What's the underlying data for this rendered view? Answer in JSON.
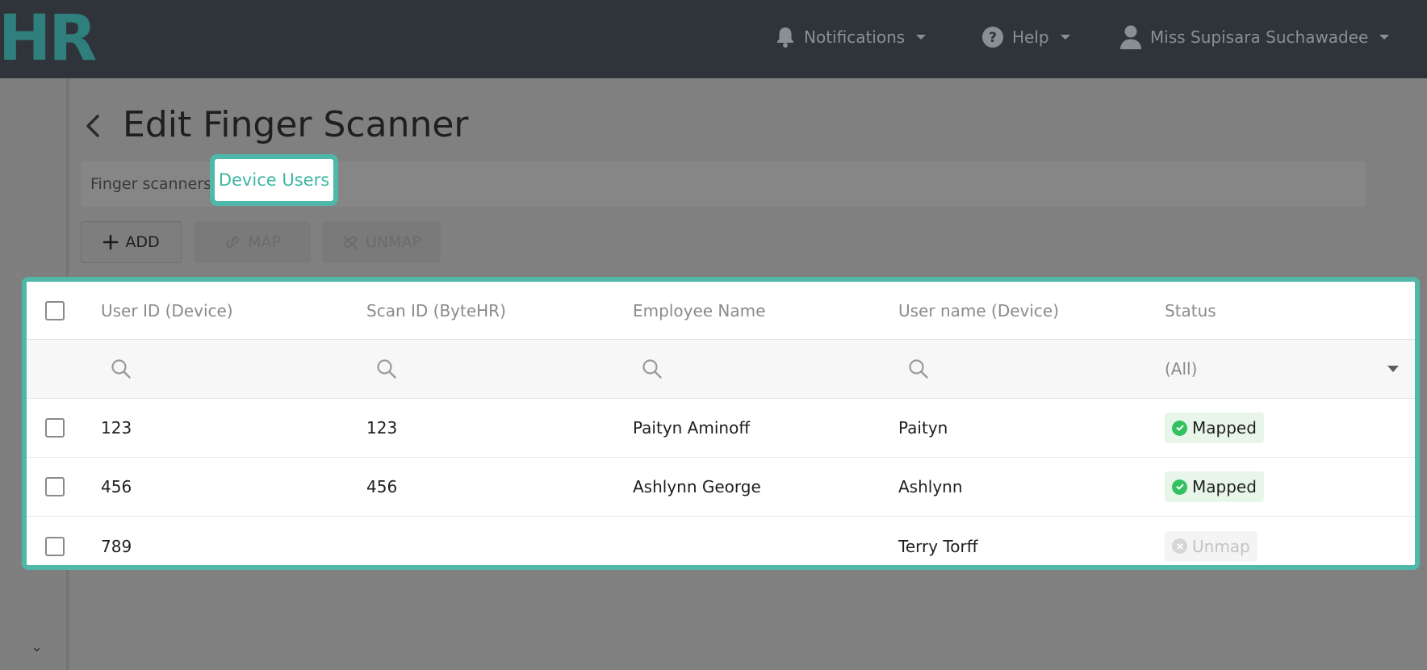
{
  "header": {
    "logo_text": "HR",
    "notifications_label": "Notifications",
    "help_label": "Help",
    "user_name": "Miss Supisara Suchawadee"
  },
  "page": {
    "title": "Edit Finger Scanner"
  },
  "tabs": [
    {
      "label": "Finger scanners",
      "active": false
    },
    {
      "label": "Device Users",
      "active": true
    }
  ],
  "toolbar": {
    "add_label": "ADD",
    "map_label": "MAP",
    "unmap_label": "UNMAP"
  },
  "grid": {
    "columns": [
      "User ID (Device)",
      "Scan ID (ByteHR)",
      "Employee Name",
      "User name (Device)",
      "Status"
    ],
    "status_filter": "(All)",
    "rows": [
      {
        "user_id": "123",
        "scan_id": "123",
        "employee_name": "Paityn Aminoff",
        "device_user_name": "Paityn",
        "status": "Mapped"
      },
      {
        "user_id": "456",
        "scan_id": "456",
        "employee_name": "Ashlynn George",
        "device_user_name": "Ashlynn",
        "status": "Mapped"
      },
      {
        "user_id": "789",
        "scan_id": "",
        "employee_name": "",
        "device_user_name": "Terry Torff",
        "status": "Unmap"
      }
    ]
  },
  "colors": {
    "accent": "#4fb8a8",
    "topbar": "#2f343b",
    "mapped_green": "#34c160"
  },
  "icons": [
    "bell-icon",
    "help-circle-icon",
    "user-icon",
    "back-arrow-icon",
    "plus-icon",
    "link-icon",
    "unlink-icon",
    "search-icon",
    "check-circle-icon",
    "x-circle-icon"
  ]
}
